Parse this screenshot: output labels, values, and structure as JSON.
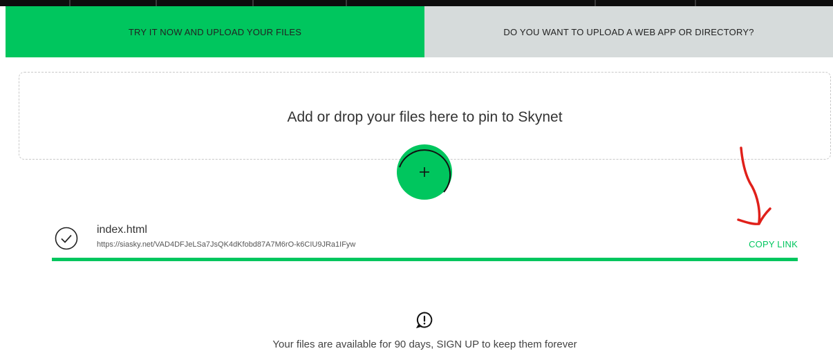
{
  "tabs": {
    "upload_files": "TRY IT NOW AND UPLOAD YOUR FILES",
    "upload_web_app": "DO YOU WANT TO UPLOAD A WEB APP OR DIRECTORY?"
  },
  "dropzone": {
    "prompt": "Add or drop your files here to pin to Skynet"
  },
  "upload": {
    "file_name": "index.html",
    "file_url": "https://siasky.net/VAD4DFJeLSa7JsQK4dKfobd87A7M6rO-k6CIU9JRa1IFyw",
    "copy_link_label": "COPY LINK",
    "progress": 1.0
  },
  "notice": {
    "text": "Your files are available for 90 days, SIGN UP to keep them forever"
  },
  "colors": {
    "accent": "#00c65e",
    "inactive_tab": "#d6dbdb",
    "annotation": "#e0201a"
  },
  "icons": [
    "plus-icon",
    "check-circle-icon",
    "alert-circle-icon",
    "arrow-annotation-icon"
  ]
}
